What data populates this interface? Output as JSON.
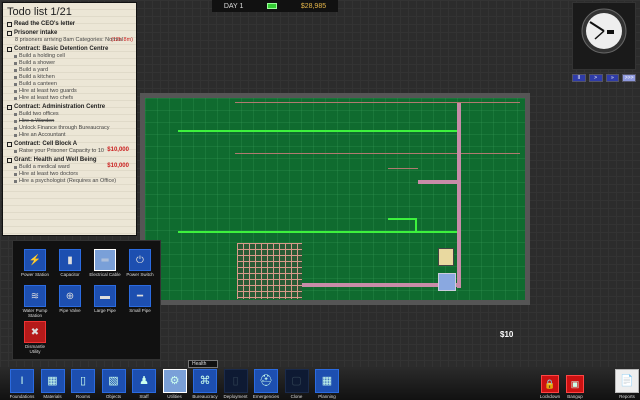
{
  "todo": {
    "title": "Todo list 1/21",
    "items": [
      {
        "label": "Read the CEO's letter"
      },
      {
        "label": "Prisoner intake",
        "desc": "8 prisoners arriving 8am Categories: Normal",
        "timer": "(12h 8m)"
      },
      {
        "label": "Contract: Basic Detention Centre",
        "subs": [
          "Build a holding cell",
          "Build a shower",
          "Build a yard",
          "Build a kitchen",
          "Build a canteen",
          "Hire at least two guards",
          "Hire at least two chefs"
        ]
      },
      {
        "label": "Contract: Administration Centre",
        "subs": [
          "Build two offices",
          "Hire a Warden",
          "Unlock Finance through Bureaucracy",
          "Hire an Accountant"
        ]
      },
      {
        "label": "Contract: Cell Block A",
        "reward": "$10,000",
        "subs": [
          "Raise your Prisoner Capacity to 10"
        ]
      },
      {
        "label": "Grant: Health and Well Being",
        "reward": "$10,000",
        "subs": [
          "Build a medical ward",
          "Hire at least two doctors",
          "Hire a psychologist (Requires an Office)"
        ]
      }
    ]
  },
  "topbar": {
    "day": "DAY 1",
    "money": "$28,985"
  },
  "speed_buttons": [
    "II",
    ">",
    "»",
    ">>>"
  ],
  "build_menu": [
    {
      "label": "Power Station",
      "icon": "⚡"
    },
    {
      "label": "Capacitor",
      "icon": "▮"
    },
    {
      "label": "Electrical Cable",
      "icon": "═"
    },
    {
      "label": "Power Switch",
      "icon": "⏻"
    },
    {
      "label": "Water Pump Station",
      "icon": "≋"
    },
    {
      "label": "Pipe Valve",
      "icon": "⊕"
    },
    {
      "label": "Large Pipe",
      "icon": "▬"
    },
    {
      "label": "Small Pipe",
      "icon": "━"
    },
    {
      "label": "Dismantle Utility",
      "icon": "✖"
    }
  ],
  "toolbar": [
    {
      "label": "Foundations",
      "icon": "I"
    },
    {
      "label": "Materials",
      "icon": "▦"
    },
    {
      "label": "Rooms",
      "icon": "▯"
    },
    {
      "label": "Objects",
      "icon": "▧"
    },
    {
      "label": "Staff",
      "icon": "♟"
    },
    {
      "label": "Utilities",
      "icon": "⚙"
    },
    {
      "label": "Bureaucracy",
      "icon": "⌘"
    },
    {
      "label": "Deployment",
      "icon": "▯"
    },
    {
      "label": "Emergencies",
      "icon": "⛑"
    },
    {
      "label": "Clone",
      "icon": "▢"
    },
    {
      "label": "Planning",
      "icon": "▦"
    }
  ],
  "right_toolbar": [
    {
      "label": "Lockdown",
      "icon": "🔒"
    },
    {
      "label": "Bangup",
      "icon": "▣"
    },
    {
      "label": "Reports",
      "icon": "📄"
    }
  ],
  "tooltip": "Health",
  "reward_text": "$10"
}
